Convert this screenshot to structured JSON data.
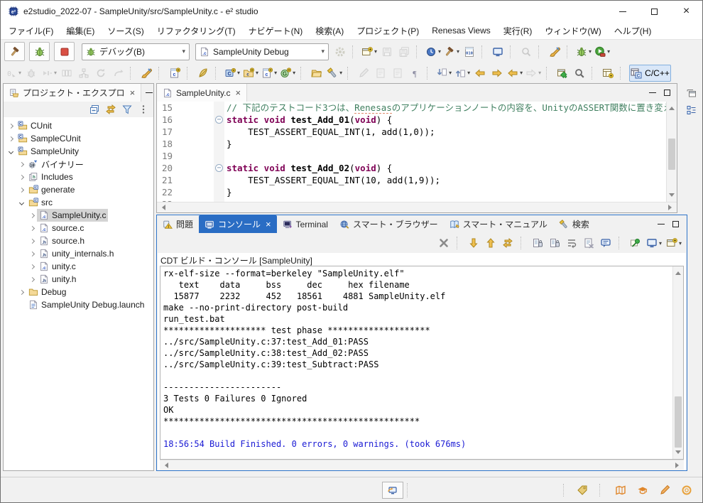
{
  "window": {
    "title": "e2studio_2022-07 - SampleUnity/src/SampleUnity.c - e² studio"
  },
  "menu": {
    "items": [
      "ファイル(F)",
      "編集(E)",
      "ソース(S)",
      "リファクタリング(T)",
      "ナビゲート(N)",
      "検索(A)",
      "プロジェクト(P)",
      "Renesas Views",
      "実行(R)",
      "ウィンドウ(W)",
      "ヘルプ(H)"
    ]
  },
  "toolbar": {
    "row1a": [
      {
        "name": "build-button",
        "icon": "hammer"
      },
      {
        "name": "debug-button",
        "icon": "bug"
      },
      {
        "name": "stop-button",
        "icon": "stop"
      }
    ],
    "debug_config": {
      "label": "デバッグ(B)"
    },
    "launch_config": {
      "label": "SampleUnity Debug"
    },
    "row1b": [
      {
        "name": "launch-settings-button",
        "icon": "gear",
        "disabled": true
      },
      {
        "sep": true
      },
      {
        "name": "new-wizard-dropdown",
        "icon": "newwin",
        "dropdown": true
      },
      {
        "name": "save-button",
        "icon": "save",
        "disabled": true
      },
      {
        "name": "save-all-button",
        "icon": "saveall",
        "disabled": true
      },
      {
        "sep": true
      },
      {
        "name": "history-dropdown",
        "icon": "clock",
        "dropdown": true
      },
      {
        "name": "build-all-dropdown",
        "icon": "hammer",
        "dropdown": true
      },
      {
        "name": "binary-utility-button",
        "icon": "binary010"
      },
      {
        "sep": true
      },
      {
        "name": "memory-view-button",
        "icon": "monitor"
      },
      {
        "sep": true
      },
      {
        "name": "inspect-button",
        "icon": "magnifiergray",
        "disabled": true
      },
      {
        "sep": true
      },
      {
        "name": "refactor-button",
        "icon": "brush"
      },
      {
        "sep": true
      },
      {
        "name": "debug-config-dropdown",
        "icon": "bug",
        "dropdown": true
      },
      {
        "name": "run-dropdown",
        "icon": "run",
        "dropdown": true
      }
    ],
    "row2": [
      {
        "name": "trace-button",
        "icon": "gray0",
        "disabled": true,
        "dropdown": true
      },
      {
        "name": "restart-debug-button",
        "icon": "graybug",
        "disabled": true
      },
      {
        "name": "resume-button",
        "icon": "graystep",
        "disabled": true,
        "dropdown": true
      },
      {
        "name": "columns-button",
        "icon": "graycols",
        "disabled": true
      },
      {
        "name": "profile-button",
        "icon": "graynet",
        "disabled": true
      },
      {
        "name": "reload-button",
        "icon": "grayreload",
        "disabled": true
      },
      {
        "name": "undo-build-button",
        "icon": "grayundo",
        "disabled": true
      },
      {
        "sep": true
      },
      {
        "name": "code-verify-button",
        "icon": "brush"
      },
      {
        "sep": true
      },
      {
        "name": "new-c-source-button",
        "icon": "newc"
      },
      {
        "sep": true
      },
      {
        "name": "feather-button",
        "icon": "feather"
      },
      {
        "sep": true
      },
      {
        "name": "new-c-project-dropdown",
        "icon": "cprojnew",
        "dropdown": true
      },
      {
        "name": "new-cpp-project-dropdown",
        "icon": "cfoldernew",
        "dropdown": true
      },
      {
        "name": "new-c-file-dropdown",
        "icon": "cfilenew",
        "dropdown": true
      },
      {
        "name": "new-class-dropdown",
        "icon": "gclass",
        "dropdown": true
      },
      {
        "sep": true
      },
      {
        "name": "open-element-button",
        "icon": "folderopen"
      },
      {
        "name": "search-torch-dropdown",
        "icon": "torch",
        "dropdown": true
      },
      {
        "sep": true
      },
      {
        "name": "format-button",
        "icon": "graypencil",
        "disabled": true
      },
      {
        "name": "open-declaration-button",
        "icon": "graydoc",
        "disabled": true
      },
      {
        "name": "open-type-button",
        "icon": "graydoc",
        "disabled": true
      },
      {
        "name": "show-whitespace-button",
        "icon": "pilcrow"
      },
      {
        "sep": true
      },
      {
        "name": "next-annotation-dropdown",
        "icon": "arrdowng",
        "dropdown": true
      },
      {
        "name": "prev-annotation-dropdown",
        "icon": "arrupg",
        "dropdown": true
      },
      {
        "name": "last-edit-back-button",
        "icon": "arrlefty"
      },
      {
        "name": "last-edit-forward-button",
        "icon": "arrrighty"
      },
      {
        "name": "back-dropdown",
        "icon": "arrlefty",
        "dropdown": true
      },
      {
        "name": "forward-dropdown",
        "icon": "arrrightgray",
        "dropdown": true,
        "disabled": true
      },
      {
        "sep": true
      },
      {
        "name": "pin-editor-button",
        "icon": "pinwin"
      },
      {
        "name": "search-button",
        "icon": "magnifier"
      },
      {
        "sep": true
      },
      {
        "name": "open-perspective-button",
        "icon": "perspnew"
      }
    ],
    "perspective_label": "C/C++"
  },
  "explorer": {
    "tab_title": "プロジェクト・エクスプロ",
    "toolbar": [
      {
        "name": "collapse-all-button",
        "icon": "collapseall"
      },
      {
        "name": "link-editor-button",
        "icon": "swap"
      },
      {
        "name": "filter-button",
        "icon": "funnel"
      },
      {
        "name": "view-menu-button",
        "icon": "vdots"
      }
    ],
    "tree": [
      {
        "label": "CUnit",
        "level": 0,
        "arrow": "collapsed",
        "icon": "cproject"
      },
      {
        "label": "SampleCUnit",
        "level": 0,
        "arrow": "collapsed",
        "icon": "cproject"
      },
      {
        "label": "SampleUnity",
        "level": 0,
        "arrow": "expanded",
        "icon": "cproject"
      },
      {
        "label": "バイナリー",
        "level": 1,
        "arrow": "collapsed",
        "icon": "binary"
      },
      {
        "label": "Includes",
        "level": 1,
        "arrow": "collapsed",
        "icon": "includes"
      },
      {
        "label": "generate",
        "level": 1,
        "arrow": "collapsed",
        "icon": "cfolder"
      },
      {
        "label": "src",
        "level": 1,
        "arrow": "expanded",
        "icon": "cfolder"
      },
      {
        "label": "SampleUnity.c",
        "level": 2,
        "arrow": "collapsed",
        "icon": "cfile",
        "selected": true
      },
      {
        "label": "source.c",
        "level": 2,
        "arrow": "collapsed",
        "icon": "cfile"
      },
      {
        "label": "source.h",
        "level": 2,
        "arrow": "collapsed",
        "icon": "hfile"
      },
      {
        "label": "unity_internals.h",
        "level": 2,
        "arrow": "collapsed",
        "icon": "hfile"
      },
      {
        "label": "unity.c",
        "level": 2,
        "arrow": "collapsed",
        "icon": "cfile"
      },
      {
        "label": "unity.h",
        "level": 2,
        "arrow": "collapsed",
        "icon": "hfile"
      },
      {
        "label": "Debug",
        "level": 1,
        "arrow": "collapsed",
        "icon": "folder"
      },
      {
        "label": "SampleUnity Debug.launch",
        "level": 1,
        "arrow": "none",
        "icon": "launchf"
      }
    ]
  },
  "editor": {
    "tab_title": "SampleUnity.c",
    "lines": [
      {
        "no": "15",
        "segments": [
          {
            "t": "// 下記のテストコード3つは、",
            "c": "cm"
          },
          {
            "t": "Renesas",
            "c": "cmm"
          },
          {
            "t": "のアプリケーションノートの内容を、UnityのASSERT関数に置き変えたもの",
            "c": "cm"
          }
        ]
      },
      {
        "no": "16",
        "fold": true,
        "segments": [
          {
            "t": "static void ",
            "c": "kw"
          },
          {
            "t": "test_Add_01",
            "c": "fn"
          },
          {
            "t": "(",
            "c": "pl"
          },
          {
            "t": "void",
            "c": "kw"
          },
          {
            "t": ") {",
            "c": "pl"
          }
        ]
      },
      {
        "no": "17",
        "segments": [
          {
            "t": "    TEST_ASSERT_EQUAL_INT(1, add(1,0));",
            "c": "pl"
          }
        ]
      },
      {
        "no": "18",
        "segments": [
          {
            "t": "}",
            "c": "pl"
          }
        ]
      },
      {
        "no": "19",
        "segments": []
      },
      {
        "no": "20",
        "fold": true,
        "segments": [
          {
            "t": "static void ",
            "c": "kw"
          },
          {
            "t": "test_Add_02",
            "c": "fn"
          },
          {
            "t": "(",
            "c": "pl"
          },
          {
            "t": "void",
            "c": "kw"
          },
          {
            "t": ") {",
            "c": "pl"
          }
        ]
      },
      {
        "no": "21",
        "segments": [
          {
            "t": "    TEST_ASSERT_EQUAL_INT(10, add(1,9));",
            "c": "pl"
          }
        ]
      },
      {
        "no": "22",
        "segments": [
          {
            "t": "}",
            "c": "pl"
          }
        ]
      },
      {
        "no": "23",
        "segments": []
      }
    ]
  },
  "console": {
    "tabs": [
      {
        "label": "問題",
        "icon": "warn",
        "name": "tab-problems"
      },
      {
        "label": "コンソール",
        "icon": "consoleicon",
        "name": "tab-console",
        "active": true
      },
      {
        "label": "Terminal",
        "icon": "terminal",
        "name": "tab-terminal"
      },
      {
        "label": "スマート・ブラウザー",
        "icon": "globe",
        "name": "tab-smart-browser"
      },
      {
        "label": "スマート・マニュアル",
        "icon": "book",
        "name": "tab-smart-manual"
      },
      {
        "label": "検索",
        "icon": "torch",
        "name": "tab-search"
      }
    ],
    "toolbar": [
      {
        "name": "remove-launch-button",
        "icon": "grayx"
      },
      {
        "sep": true
      },
      {
        "name": "show-next-button",
        "icon": "arrdowny"
      },
      {
        "name": "show-prev-button",
        "icon": "arrupy"
      },
      {
        "name": "follow-output-button",
        "icon": "swap",
        "active": true
      },
      {
        "sep": true
      },
      {
        "name": "scroll-lock-button",
        "icon": "scrolllock"
      },
      {
        "name": "pause-output-button",
        "icon": "scrolllock"
      },
      {
        "name": "word-wrap-button",
        "icon": "wrap"
      },
      {
        "name": "clear-console-button",
        "icon": "clearcon"
      },
      {
        "name": "activate-on-output-button",
        "icon": "bubble",
        "active": true
      },
      {
        "sep": true
      },
      {
        "name": "pin-console-button",
        "icon": "pin"
      },
      {
        "name": "display-console-dropdown",
        "icon": "monitor",
        "dropdown": true
      },
      {
        "name": "open-console-dropdown",
        "icon": "newwin",
        "dropdown": true
      }
    ],
    "header": "CDT ビルド・コンソール [SampleUnity]",
    "output": "rx-elf-size --format=berkeley \"SampleUnity.elf\"\n   text\t   data\t    bss\t    dec\t    hex\tfilename\n  15877\t   2232\t    452\t  18561\t   4881\tSampleUnity.elf\nmake --no-print-directory post-build\nrun_test.bat\n******************** test phase ********************\n../src/SampleUnity.c:37:test_Add_01:PASS\n../src/SampleUnity.c:38:test_Add_02:PASS\n../src/SampleUnity.c:39:test_Subtract:PASS\n\n-----------------------\n3 Tests 0 Failures 0 Ignored\nOK\n**************************************************\n\n",
    "final_line": "18:56:54 Build Finished. 0 errors, 0 warnings. (took 676ms)"
  },
  "statusbar": {
    "right_icons": [
      {
        "name": "whats-new-button",
        "icon": "tag"
      },
      {
        "sep": true
      },
      {
        "name": "manual-button",
        "icon": "map"
      },
      {
        "name": "training-button",
        "icon": "cap"
      },
      {
        "name": "feedback-button",
        "icon": "pencil"
      },
      {
        "name": "support-button",
        "icon": "ring"
      }
    ]
  }
}
